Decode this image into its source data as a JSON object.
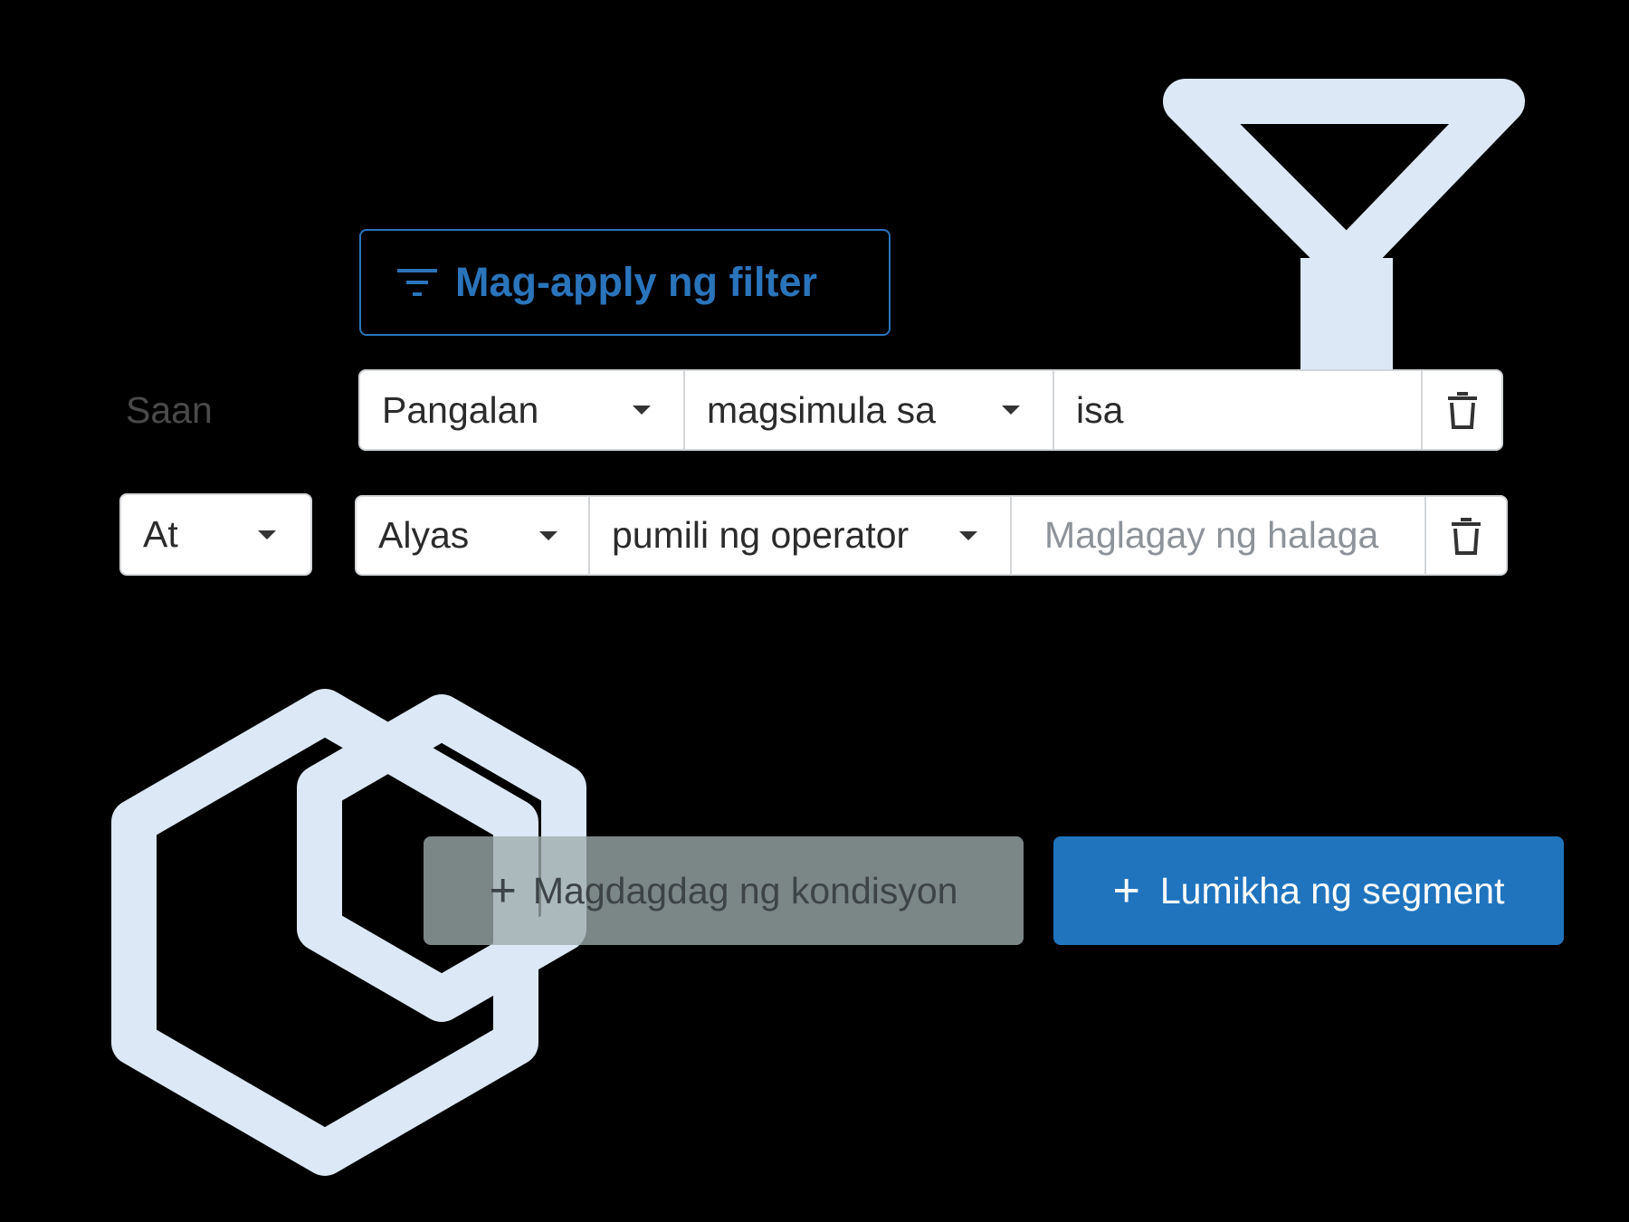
{
  "apply_filter": {
    "label": "Mag-apply ng filter",
    "icon": "filter-lines-icon"
  },
  "where_label": "Saan",
  "conditions": [
    {
      "field": "Pangalan",
      "operator": "magsimula sa",
      "value": "isa",
      "placeholder": ""
    },
    {
      "connector": "At",
      "field": "Alyas",
      "operator": "pumili ng operator",
      "value": "",
      "placeholder": "Maglagay ng halaga"
    }
  ],
  "add_condition": {
    "icon": "+",
    "label": "Magdagdag ng kondisyon"
  },
  "create_segment": {
    "icon": "+",
    "label": "Lumikha ng segment"
  },
  "colors": {
    "accent": "#2074be",
    "decoration": "#dce8f5",
    "background": "#000000"
  }
}
